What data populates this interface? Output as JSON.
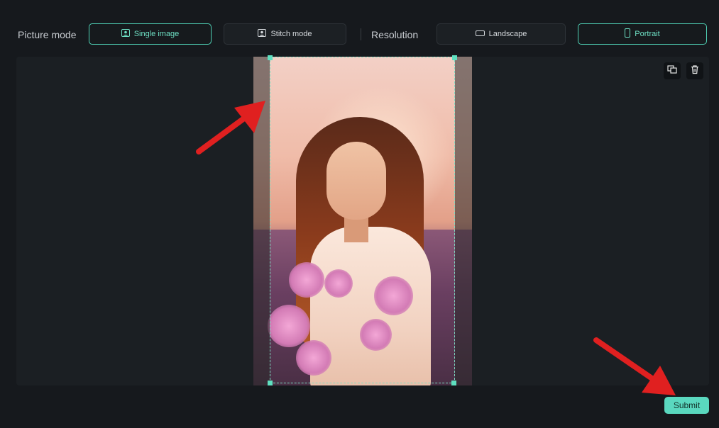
{
  "toolbar": {
    "picture_mode_label": "Picture mode",
    "single_image_label": "Single image",
    "stitch_mode_label": "Stitch mode",
    "resolution_label": "Resolution",
    "landscape_label": "Landscape",
    "portrait_label": "Portrait",
    "selected_picture_mode": "Single image",
    "selected_resolution": "Portrait"
  },
  "canvas": {
    "image_icons": [
      "replace-image-icon",
      "trash-icon"
    ]
  },
  "footer": {
    "submit_label": "Submit"
  },
  "colors": {
    "accent": "#5ad8bf",
    "background": "#16191d",
    "annotation_arrow": "#e02020"
  }
}
